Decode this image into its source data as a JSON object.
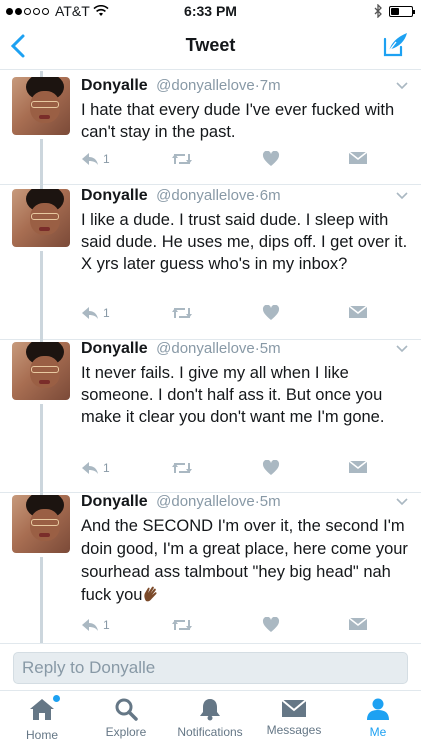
{
  "status_bar": {
    "carrier": "AT&T",
    "time": "6:33 PM",
    "battery_percent": 40
  },
  "header": {
    "title": "Tweet"
  },
  "tweets": [
    {
      "name": "Donyalle",
      "handle": "@donyallelove",
      "separator": "·",
      "time": "7m",
      "text": "I hate that every dude I've ever fucked with can't stay in the past.",
      "reply_count": "1"
    },
    {
      "name": "Donyalle",
      "handle": "@donyallelove",
      "separator": "·",
      "time": "6m",
      "text": "I like a dude. I trust said dude. I sleep with said dude. He uses me, dips off. I get over it. X yrs later guess who's in my inbox?",
      "reply_count": "1"
    },
    {
      "name": "Donyalle",
      "handle": "@donyallelove",
      "separator": "·",
      "time": "5m",
      "text": "It never fails. I give my all when I like someone. I don't half ass it. But once you make it clear you don't want me I'm gone.",
      "reply_count": "1"
    },
    {
      "name": "Donyalle",
      "handle": "@donyallelove",
      "separator": "·",
      "time": "5m",
      "text": "And the SECOND I'm over it, the second I'm doin good, I'm a great place, here come your sourhead ass talmbout \"hey big head\" nah fuck you",
      "reply_count": "1"
    }
  ],
  "reply": {
    "placeholder": "Reply to Donyalle"
  },
  "tabs": [
    {
      "label": "Home",
      "icon": "home-icon"
    },
    {
      "label": "Explore",
      "icon": "search-icon"
    },
    {
      "label": "Notifications",
      "icon": "bell-icon"
    },
    {
      "label": "Messages",
      "icon": "envelope-icon"
    },
    {
      "label": "Me",
      "icon": "person-icon"
    }
  ],
  "colors": {
    "accent": "#1da1f2",
    "icon_gray": "#aab8c2",
    "text_gray": "#8899a6"
  }
}
